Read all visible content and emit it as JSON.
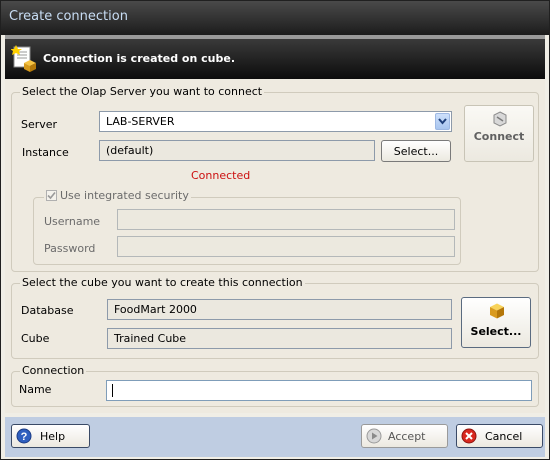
{
  "window": {
    "title": "Create connection"
  },
  "banner": {
    "message": "Connection is created on cube."
  },
  "server_section": {
    "legend": "Select the Olap Server you want to connect",
    "server_label": "Server",
    "server_value": "LAB-SERVER",
    "instance_label": "Instance",
    "instance_value": "(default)",
    "select_button": "Select...",
    "connect_button": "Connect",
    "status": "Connected",
    "security": {
      "checkbox_label": "Use integrated security",
      "checked": true,
      "username_label": "Username",
      "username_value": "",
      "password_label": "Password",
      "password_value": ""
    }
  },
  "cube_section": {
    "legend": "Select the cube you want to create this connection",
    "database_label": "Database",
    "database_value": "FoodMart 2000",
    "cube_label": "Cube",
    "cube_value": "Trained Cube",
    "select_button": "Select..."
  },
  "connection_section": {
    "legend": "Connection",
    "name_label": "Name",
    "name_value": ""
  },
  "footer": {
    "help_button": "Help",
    "accept_button": "Accept",
    "cancel_button": "Cancel"
  },
  "colors": {
    "status": "#cc1010",
    "title_text": "#c8ddf4",
    "footer_bg": "#bfcde2"
  }
}
